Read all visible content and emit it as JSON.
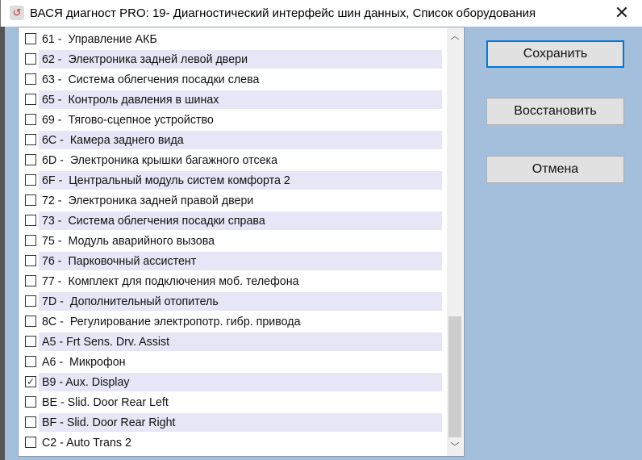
{
  "window": {
    "title": "ВАСЯ диагност PRO: 19- Диагностический интерфейс шин данных,  Список оборудования",
    "close_label": "✕"
  },
  "buttons": {
    "save": "Сохранить",
    "restore": "Восстановить",
    "cancel": "Отмена"
  },
  "items": [
    {
      "label": "61 -  Управление АКБ",
      "checked": false
    },
    {
      "label": "62 -  Электроника задней левой двери",
      "checked": false
    },
    {
      "label": "63 -  Система облегчения посадки слева",
      "checked": false
    },
    {
      "label": "65 -  Контроль давления в шинах",
      "checked": false
    },
    {
      "label": "69 -  Тягово-сцепное устройство",
      "checked": false
    },
    {
      "label": "6C -  Камера заднего вида",
      "checked": false
    },
    {
      "label": "6D -  Электроника крышки багажного отсека",
      "checked": false
    },
    {
      "label": "6F -  Центральный модуль систем комфорта 2",
      "checked": false
    },
    {
      "label": "72 -  Электроника задней правой двери",
      "checked": false
    },
    {
      "label": "73 -  Система облегчения посадки справа",
      "checked": false
    },
    {
      "label": "75 -  Модуль аварийного вызова",
      "checked": false
    },
    {
      "label": "76 -  Парковочный ассистент",
      "checked": false
    },
    {
      "label": "77 -  Комплект для подключения моб. телефона",
      "checked": false
    },
    {
      "label": "7D -  Дополнительный отопитель",
      "checked": false
    },
    {
      "label": "8C -  Регулирование электропотр. гибр. привода",
      "checked": false
    },
    {
      "label": "A5 - Frt Sens. Drv. Assist",
      "checked": false
    },
    {
      "label": "A6 -  Микрофон",
      "checked": false
    },
    {
      "label": "B9 - Aux. Display",
      "checked": true
    },
    {
      "label": "BE - Slid. Door Rear Left",
      "checked": false
    },
    {
      "label": "BF - Slid. Door Rear Right",
      "checked": false
    },
    {
      "label": "C2 - Auto Trans 2",
      "checked": false
    }
  ]
}
